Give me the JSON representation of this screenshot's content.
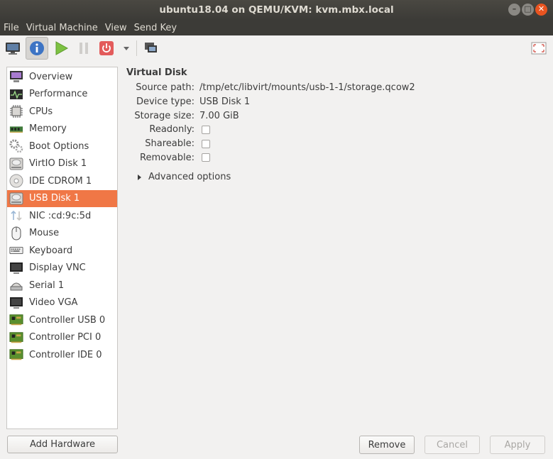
{
  "window": {
    "title": "ubuntu18.04 on QEMU/KVM: kvm.mbx.local"
  },
  "menubar": [
    "File",
    "Virtual Machine",
    "View",
    "Send Key"
  ],
  "sidebar": {
    "items": [
      {
        "label": "Overview",
        "icon": "overview-icon"
      },
      {
        "label": "Performance",
        "icon": "performance-icon"
      },
      {
        "label": "CPUs",
        "icon": "cpu-icon"
      },
      {
        "label": "Memory",
        "icon": "memory-icon"
      },
      {
        "label": "Boot Options",
        "icon": "boot-options-icon"
      },
      {
        "label": "VirtIO Disk 1",
        "icon": "disk-icon"
      },
      {
        "label": "IDE CDROM 1",
        "icon": "cdrom-icon"
      },
      {
        "label": "USB Disk 1",
        "icon": "disk-icon",
        "selected": true
      },
      {
        "label": "NIC :cd:9c:5d",
        "icon": "network-icon"
      },
      {
        "label": "Mouse",
        "icon": "mouse-icon"
      },
      {
        "label": "Keyboard",
        "icon": "keyboard-icon"
      },
      {
        "label": "Display VNC",
        "icon": "display-icon"
      },
      {
        "label": "Serial 1",
        "icon": "serial-icon"
      },
      {
        "label": "Video VGA",
        "icon": "video-icon"
      },
      {
        "label": "Controller USB 0",
        "icon": "controller-icon"
      },
      {
        "label": "Controller PCI 0",
        "icon": "controller-icon"
      },
      {
        "label": "Controller IDE 0",
        "icon": "controller-icon"
      }
    ],
    "add_hardware": "Add Hardware"
  },
  "detail": {
    "title": "Virtual Disk",
    "source_path_label": "Source path:",
    "source_path": "/tmp/etc/libvirt/mounts/usb-1-1/storage.qcow2",
    "device_type_label": "Device type:",
    "device_type": "USB Disk 1",
    "storage_size_label": "Storage size:",
    "storage_size": "7.00 GiB",
    "readonly_label": "Readonly:",
    "shareable_label": "Shareable:",
    "removable_label": "Removable:",
    "advanced_options": "Advanced options"
  },
  "buttons": {
    "remove": "Remove",
    "cancel": "Cancel",
    "apply": "Apply"
  },
  "colors": {
    "accent": "#f07746",
    "titlebar": "#3c3b37",
    "close": "#e95420"
  }
}
